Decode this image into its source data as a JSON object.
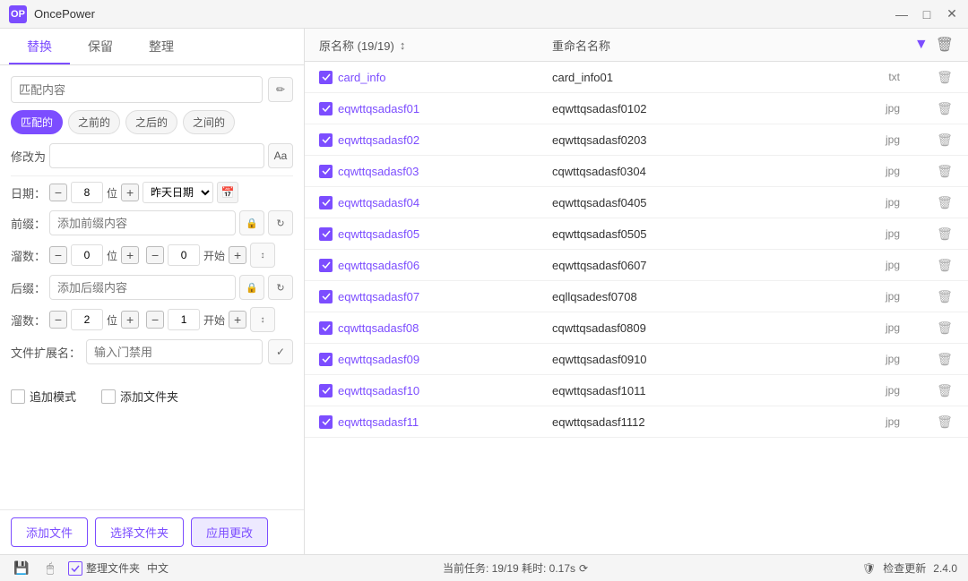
{
  "app": {
    "title": "OncePower",
    "icon_text": "OP"
  },
  "window_controls": {
    "minimize": "—",
    "maximize": "□",
    "close": "✕"
  },
  "tabs": [
    {
      "label": "替换",
      "active": true
    },
    {
      "label": "保留",
      "active": false
    },
    {
      "label": "整理",
      "active": false
    }
  ],
  "match_section": {
    "label": "匹配内容",
    "placeholder": "匹配内容"
  },
  "match_types": [
    {
      "label": "匹配的",
      "active": true
    },
    {
      "label": "之前的",
      "active": false
    },
    {
      "label": "之后的",
      "active": false
    },
    {
      "label": "之间的",
      "active": false
    }
  ],
  "modify_section": {
    "label": "修改为",
    "placeholder": ""
  },
  "date_section": {
    "label": "日期：",
    "minus": "-",
    "digits": "8",
    "digits_unit": "位",
    "plus": "+",
    "date_value": "昨天日期",
    "cal_icon": "📅"
  },
  "prefix_section": {
    "label": "前缀：",
    "placeholder": "添加前缀内容"
  },
  "serial_prefix": {
    "label": "溜数：",
    "minus1": "-",
    "val1": "0",
    "unit1": "位",
    "plus1": "+",
    "minus2": "-",
    "val2": "0",
    "unit2": "开始",
    "plus2": "+"
  },
  "suffix_section": {
    "label": "后缀：",
    "placeholder": "添加后缀内容"
  },
  "serial_suffix": {
    "label": "溜数：",
    "minus1": "-",
    "val1": "2",
    "unit1": "位",
    "plus1": "+",
    "minus2": "-",
    "val2": "1",
    "unit2": "开始",
    "plus2": "+"
  },
  "ext_section": {
    "label": "文件扩展名：",
    "placeholder": "输入门禁用"
  },
  "checkboxes": [
    {
      "label": "追加模式",
      "checked": false
    },
    {
      "label": "添加文件夹",
      "checked": false
    }
  ],
  "action_buttons": {
    "add_file": "添加文件",
    "select_folder": "选择文件夹",
    "apply": "应用更改"
  },
  "file_list_header": {
    "orig_name": "原名称 (19/19)",
    "sort_icon": "↕",
    "new_name": "重命名名称",
    "filter_icon": "▼",
    "trash_icon": "🗑"
  },
  "files": [
    {
      "checked": true,
      "orig": "card_info",
      "new_name": "card_info01",
      "ext": "txt"
    },
    {
      "checked": true,
      "orig": "eqwttqsadasf01",
      "new_name": "eqwttqsadasf0102",
      "ext": "jpg"
    },
    {
      "checked": true,
      "orig": "eqwttqsadasf02",
      "new_name": "eqwttqsadasf0203",
      "ext": "jpg"
    },
    {
      "checked": true,
      "orig": "cqwttqsadasf03",
      "new_name": "cqwttqsadasf0304",
      "ext": "jpg"
    },
    {
      "checked": true,
      "orig": "eqwttqsadasf04",
      "new_name": "eqwttqsadasf0405",
      "ext": "jpg"
    },
    {
      "checked": true,
      "orig": "eqwttqsadasf05",
      "new_name": "eqwttqsadasf0505",
      "ext": "jpg"
    },
    {
      "checked": true,
      "orig": "eqwttqsadasf06",
      "new_name": "eqwttqsadasf0607",
      "ext": "jpg"
    },
    {
      "checked": true,
      "orig": "eqwttqsadasf07",
      "new_name": "eqllqsadesf0708",
      "ext": "jpg"
    },
    {
      "checked": true,
      "orig": "cqwttqsadasf08",
      "new_name": "cqwttqsadasf0809",
      "ext": "jpg"
    },
    {
      "checked": true,
      "orig": "eqwttqsadasf09",
      "new_name": "eqwttqsadasf0910",
      "ext": "jpg"
    },
    {
      "checked": true,
      "orig": "eqwttqsadasf10",
      "new_name": "eqwttqsadasf1011",
      "ext": "jpg"
    },
    {
      "checked": true,
      "orig": "eqwttqsadasf11",
      "new_name": "eqwttqsadasf1112",
      "ext": "jpg"
    }
  ],
  "status_bar": {
    "organize_label": "整理文件夹",
    "language": "中文",
    "task_info": "当前任务: 19/19  耗时: 0.17s",
    "version": "2.4.0",
    "check_update": "检查更新"
  }
}
